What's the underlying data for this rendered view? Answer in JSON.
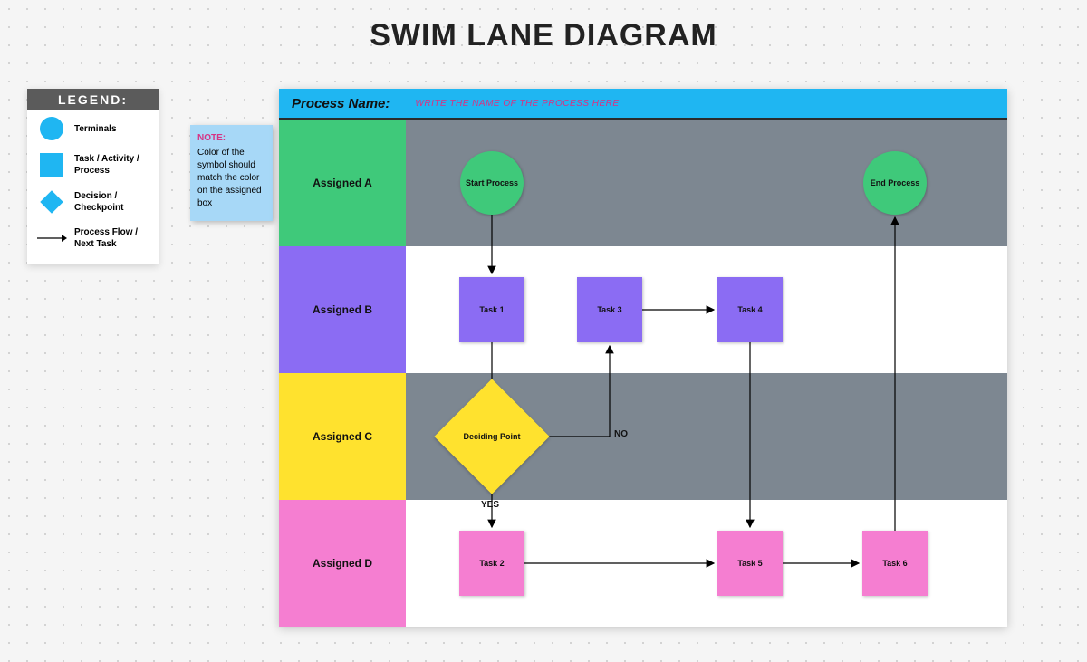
{
  "title": "SWIM LANE DIAGRAM",
  "legend": {
    "header": "LEGEND:",
    "items": [
      {
        "label": "Terminals"
      },
      {
        "label": "Task / Activity / Process"
      },
      {
        "label": "Decision / Checkpoint"
      },
      {
        "label": "Process Flow / Next Task"
      }
    ]
  },
  "note": {
    "title": "NOTE:",
    "body": "Color of the symbol should match the color on the assigned box"
  },
  "header_bar": {
    "label": "Process Name:",
    "placeholder": "WRITE THE NAME OF THE PROCESS HERE"
  },
  "lanes": [
    {
      "label": "Assigned A",
      "color": "#3fc97a"
    },
    {
      "label": "Assigned B",
      "color": "#8b6cf3"
    },
    {
      "label": "Assigned C",
      "color": "#ffe22e"
    },
    {
      "label": "Assigned D",
      "color": "#f57ed1"
    }
  ],
  "nodes": {
    "start": {
      "label": "Start Process"
    },
    "end": {
      "label": "End Process"
    },
    "task1": {
      "label": "Task 1"
    },
    "task3": {
      "label": "Task 3"
    },
    "task4": {
      "label": "Task 4"
    },
    "decide": {
      "label": "Deciding Point"
    },
    "task2": {
      "label": "Task 2"
    },
    "task5": {
      "label": "Task 5"
    },
    "task6": {
      "label": "Task 6"
    }
  },
  "edge_labels": {
    "no": "NO",
    "yes": "YES"
  },
  "chart_data": {
    "type": "swimlane-flowchart",
    "title": "SWIM LANE DIAGRAM",
    "lanes": [
      "Assigned A",
      "Assigned B",
      "Assigned C",
      "Assigned D"
    ],
    "nodes": [
      {
        "id": "start",
        "type": "terminal",
        "lane": "Assigned A",
        "label": "Start Process"
      },
      {
        "id": "task1",
        "type": "task",
        "lane": "Assigned B",
        "label": "Task 1"
      },
      {
        "id": "task3",
        "type": "task",
        "lane": "Assigned B",
        "label": "Task 3"
      },
      {
        "id": "task4",
        "type": "task",
        "lane": "Assigned B",
        "label": "Task 4"
      },
      {
        "id": "decide",
        "type": "decision",
        "lane": "Assigned C",
        "label": "Deciding Point"
      },
      {
        "id": "task2",
        "type": "task",
        "lane": "Assigned D",
        "label": "Task 2"
      },
      {
        "id": "task5",
        "type": "task",
        "lane": "Assigned D",
        "label": "Task 5"
      },
      {
        "id": "task6",
        "type": "task",
        "lane": "Assigned D",
        "label": "Task 6"
      },
      {
        "id": "end",
        "type": "terminal",
        "lane": "Assigned A",
        "label": "End Process"
      }
    ],
    "edges": [
      {
        "from": "start",
        "to": "task1"
      },
      {
        "from": "task1",
        "to": "decide"
      },
      {
        "from": "decide",
        "to": "task3",
        "label": "NO"
      },
      {
        "from": "decide",
        "to": "task2",
        "label": "YES"
      },
      {
        "from": "task3",
        "to": "task4"
      },
      {
        "from": "task4",
        "to": "task5"
      },
      {
        "from": "task2",
        "to": "task5"
      },
      {
        "from": "task5",
        "to": "task6"
      },
      {
        "from": "task6",
        "to": "end"
      }
    ]
  }
}
